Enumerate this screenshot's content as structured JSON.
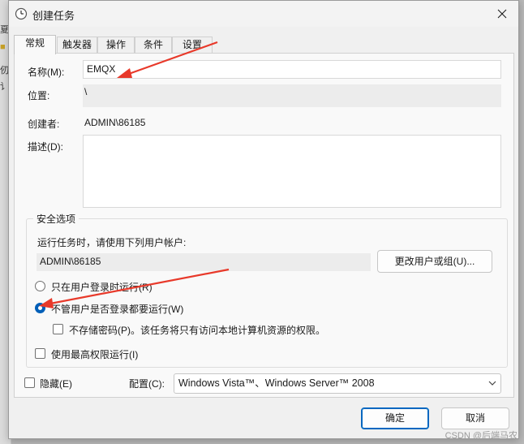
{
  "background": {
    "fragments": [
      "夏",
      "■",
      "仞",
      "讠"
    ]
  },
  "titlebar": {
    "title": "创建任务",
    "close_glyph": "✕"
  },
  "tabs": [
    {
      "label": "常规",
      "active": true
    },
    {
      "label": "触发器",
      "active": false
    },
    {
      "label": "操作",
      "active": false
    },
    {
      "label": "条件",
      "active": false
    },
    {
      "label": "设置",
      "active": false
    }
  ],
  "general": {
    "name_label": "名称(M):",
    "name_value": "EMQX",
    "location_label": "位置:",
    "location_value": "\\",
    "author_label": "创建者:",
    "author_value": "ADMIN\\86185",
    "description_label": "描述(D):",
    "description_value": ""
  },
  "security": {
    "group_title": "安全选项",
    "run_as_prompt": "运行任务时，请使用下列用户帐户:",
    "run_as_user": "ADMIN\\86185",
    "change_user_button": "更改用户或组(U)...",
    "radio_logged_on_only": "只在用户登录时运行(R)",
    "radio_whether_logged_on": "不管用户是否登录都要运行(W)",
    "checkbox_no_store_password": "不存储密码(P)。该任务将只有访问本地计算机资源的权限。",
    "checkbox_highest_privileges": "使用最高权限运行(I)"
  },
  "bottom": {
    "hidden_label": "隐藏(E)",
    "config_label": "配置(C):",
    "config_value": "Windows Vista™、Windows Server™ 2008",
    "ok_button": "确定",
    "cancel_button": "取消"
  },
  "state": {
    "selected_radio": "whether_logged_on",
    "no_store_password_checked": false,
    "highest_privileges_checked": false,
    "hidden_checked": false
  },
  "watermark": "CSDN @后端马农",
  "colors": {
    "accent": "#005fb8",
    "annotation_arrow": "#e8392a"
  }
}
